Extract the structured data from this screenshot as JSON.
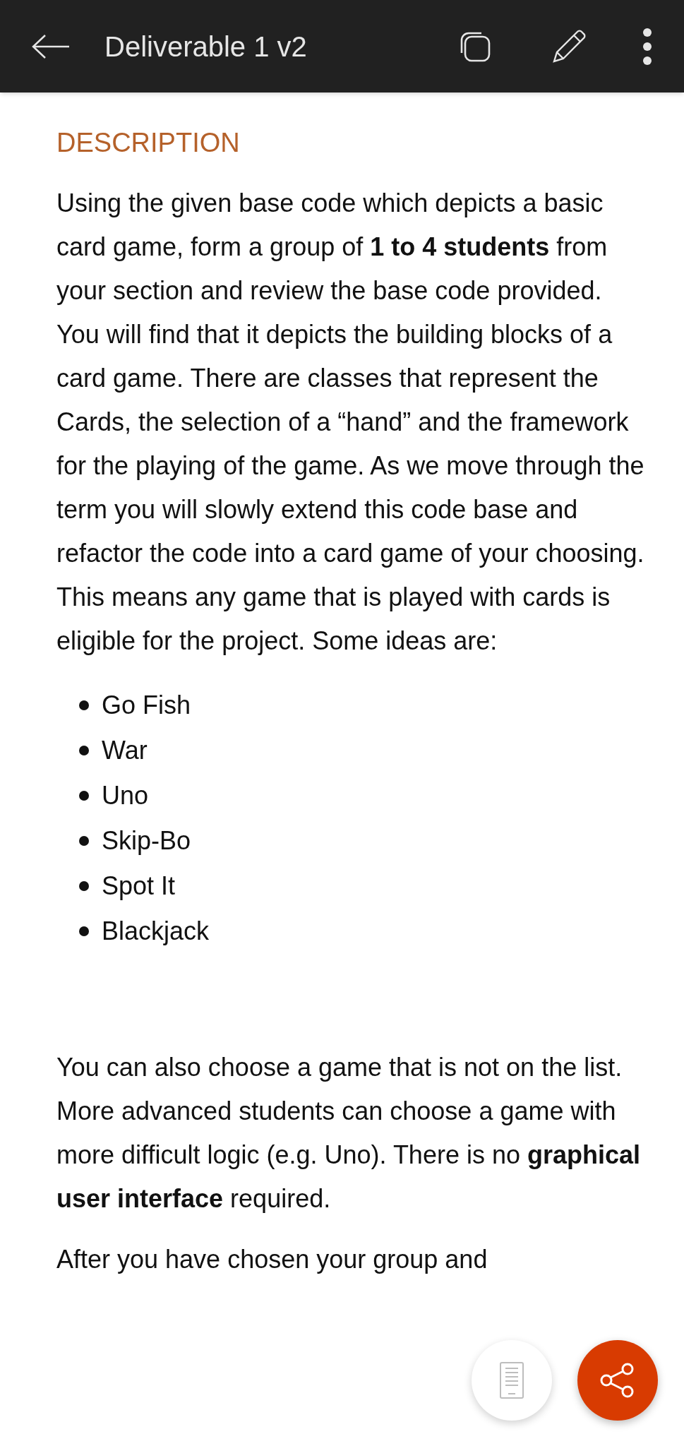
{
  "top_bar": {
    "title": "Deliverable 1 v2"
  },
  "document": {
    "heading": "DESCRIPTION",
    "paragraphs_before_list": [
      "Using the given base code which depicts a basic card game, form a group of **1 to 4 students** from your section and review the base code provided. You will find that it depicts the building blocks of a card game. There are classes that represent the Cards, the selection of a “hand” and the framework for the playing of the game. As we move through the term you will slowly extend this code base and refactor the code into a card game of your choosing. This means any game that is played with cards is eligible for the project. Some ideas are:"
    ],
    "list": [
      "Go Fish",
      "War",
      "Uno",
      "Skip-Bo",
      "Spot It",
      "Blackjack"
    ],
    "paragraphs_after_list": [
      "You can also choose a game that is not on the list. More advanced students can choose a game with more difficult logic (e.g. Uno). There is no **graphical user interface** required.",
      "After you have chosen your group and"
    ]
  }
}
